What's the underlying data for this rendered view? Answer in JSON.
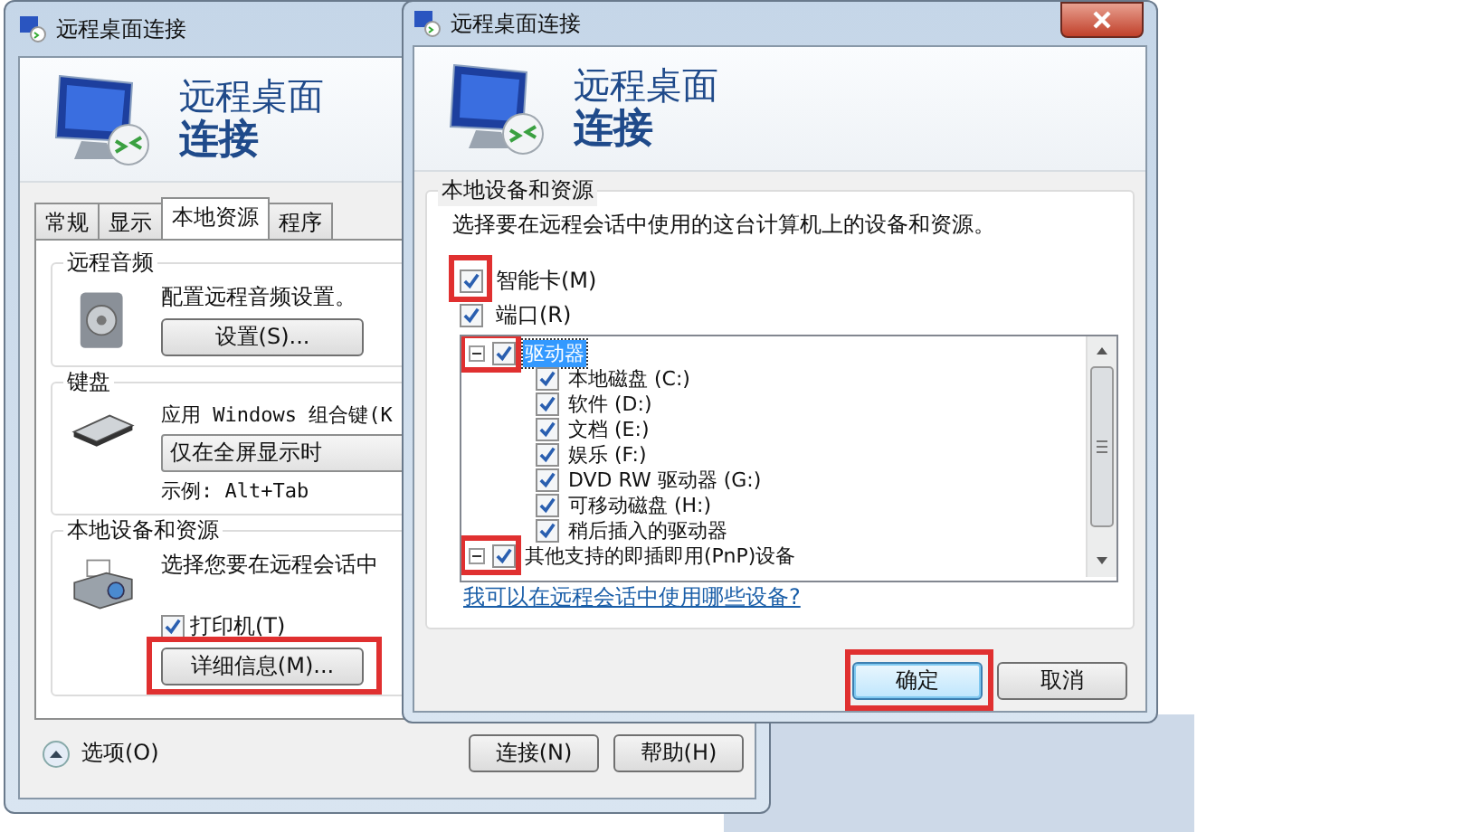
{
  "left_window": {
    "title": "远程桌面连接",
    "header": {
      "line1": "远程桌面",
      "line2": "连接"
    },
    "tabs": [
      {
        "label": "常规",
        "selected": false
      },
      {
        "label": "显示",
        "selected": false
      },
      {
        "label": "本地资源",
        "selected": true
      },
      {
        "label": "程序",
        "selected": false
      }
    ],
    "audio": {
      "label": "远程音频",
      "text": "配置远程音频设置。",
      "button": "设置(S)..."
    },
    "keyboard": {
      "label": "键盘",
      "text": "应用 Windows 组合键(K",
      "dropdown": "仅在全屏显示时",
      "example": "示例: Alt+Tab"
    },
    "local": {
      "label": "本地设备和资源",
      "text": "选择您要在远程会话中",
      "printer": {
        "label": "打印机(T)",
        "checked": true
      },
      "button": {
        "label": "详细信息(M)...",
        "highlighted": true
      }
    },
    "options": "选项(O)",
    "buttons": [
      {
        "label": "连接(N)"
      },
      {
        "label": "帮助(H)"
      }
    ]
  },
  "right_window": {
    "title": "远程桌面连接",
    "header": {
      "line1": "远程桌面",
      "line2": "连接"
    },
    "group_label": "本地设备和资源",
    "description": "选择要在远程会话中使用的这台计算机上的设备和资源。",
    "checkboxes": [
      {
        "label": "智能卡(M)",
        "checked": true,
        "highlighted": true
      },
      {
        "label": "端口(R)",
        "checked": true,
        "highlighted": false
      }
    ],
    "tree": [
      {
        "label": "驱动器",
        "checked": true,
        "selected": true,
        "expanded": true,
        "highlighted": true,
        "children": [
          {
            "label": "本地磁盘 (C:)",
            "checked": true,
            "selected": false
          },
          {
            "label": "软件 (D:)",
            "checked": true,
            "selected": false
          },
          {
            "label": "文档 (E:)",
            "checked": true,
            "selected": false
          },
          {
            "label": "娱乐 (F:)",
            "checked": true,
            "selected": false
          },
          {
            "label": "DVD RW 驱动器 (G:)",
            "checked": true,
            "selected": false
          },
          {
            "label": "可移动磁盘 (H:)",
            "checked": true,
            "selected": false
          },
          {
            "label": "稍后插入的驱动器",
            "checked": true,
            "selected": false
          }
        ]
      },
      {
        "label": "其他支持的即插即用(PnP)设备",
        "checked": true,
        "selected": false,
        "expanded": true,
        "highlighted": true
      }
    ],
    "link": "我可以在远程会话中使用哪些设备?",
    "buttons": [
      {
        "label": "确定",
        "default": true,
        "highlighted": true
      },
      {
        "label": "取消",
        "default": false,
        "highlighted": false
      }
    ]
  }
}
